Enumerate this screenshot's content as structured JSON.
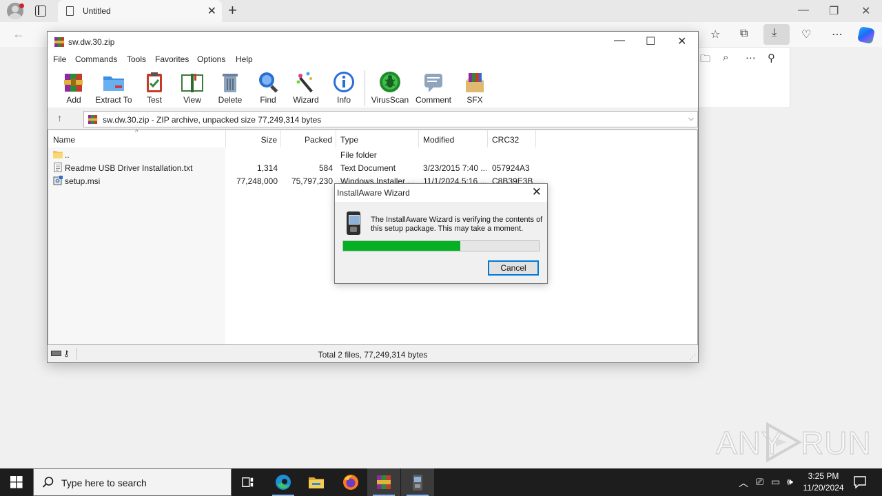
{
  "browser": {
    "tab_title": "Untitled",
    "tab_close": "✕",
    "new_tab": "+",
    "minimize": "—",
    "restore": "❐",
    "close": "✕"
  },
  "winrar": {
    "title": "sw.dw.30.zip",
    "menu": [
      "File",
      "Commands",
      "Tools",
      "Favorites",
      "Options",
      "Help"
    ],
    "toolbar": [
      "Add",
      "Extract To",
      "Test",
      "View",
      "Delete",
      "Find",
      "Wizard",
      "Info",
      "VirusScan",
      "Comment",
      "SFX"
    ],
    "address": "sw.dw.30.zip - ZIP archive, unpacked size 77,249,314 bytes",
    "columns": [
      "Name",
      "Size",
      "Packed",
      "Type",
      "Modified",
      "CRC32"
    ],
    "rows": [
      {
        "name": "..",
        "size": "",
        "packed": "",
        "type": "File folder",
        "modified": "",
        "crc": "",
        "icon": "folder-icon"
      },
      {
        "name": "Readme USB Driver Installation.txt",
        "size": "1,314",
        "packed": "584",
        "type": "Text Document",
        "modified": "3/23/2015 7:40 ...",
        "crc": "057924A3",
        "icon": "text-file-icon"
      },
      {
        "name": "setup.msi",
        "size": "77,248,000",
        "packed": "75,797,230",
        "type": "Windows Installer ...",
        "modified": "11/1/2024 5:16 ...",
        "crc": "C8B39E3B",
        "icon": "installer-icon"
      }
    ],
    "status": "Total 2 files, 77,249,314 bytes"
  },
  "dialog": {
    "title": "InstallAware Wizard",
    "message": "The InstallAware Wizard is verifying the contents of this setup package. This may take a moment.",
    "progress": 0.6,
    "cancel": "Cancel",
    "close": "✕"
  },
  "taskbar": {
    "search_placeholder": "Type here to search",
    "time": "3:25 PM",
    "date": "11/20/2024"
  },
  "watermark": {
    "left": "ANY",
    "right": "RUN"
  },
  "colors": {
    "progress": "#06b025",
    "focus_border": "#0078d7",
    "taskbar": "#1d1d1d"
  }
}
